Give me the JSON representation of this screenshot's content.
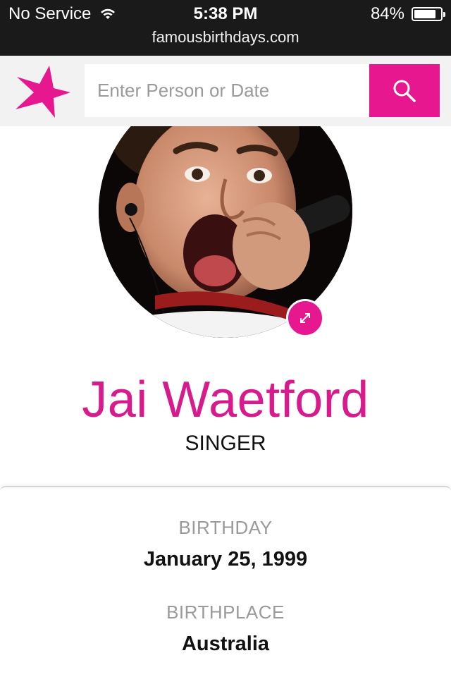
{
  "status_bar": {
    "carrier": "No Service",
    "time": "5:38 PM",
    "battery_percent": "84%",
    "battery_level": 0.84,
    "url": "famousbirthdays.com"
  },
  "header": {
    "logo_icon": "pink-star-icon",
    "search": {
      "placeholder": "Enter Person or Date",
      "value": ""
    },
    "search_icon": "magnifier-icon"
  },
  "profile": {
    "photo": "profile-photo-singer-with-microphone",
    "expand_icon": "expand-arrows-icon",
    "name": "Jai Waetford",
    "profession": "SINGER"
  },
  "details": {
    "birthday_label": "BIRTHDAY",
    "birthday_value": "January 25, 1999",
    "birthplace_label": "BIRTHPLACE",
    "birthplace_value": "Australia"
  },
  "colors": {
    "accent": "#e6178f",
    "name_color": "#d81b8c",
    "status_bar_bg": "#1a1a1a",
    "header_bg": "#f2f2f2"
  }
}
